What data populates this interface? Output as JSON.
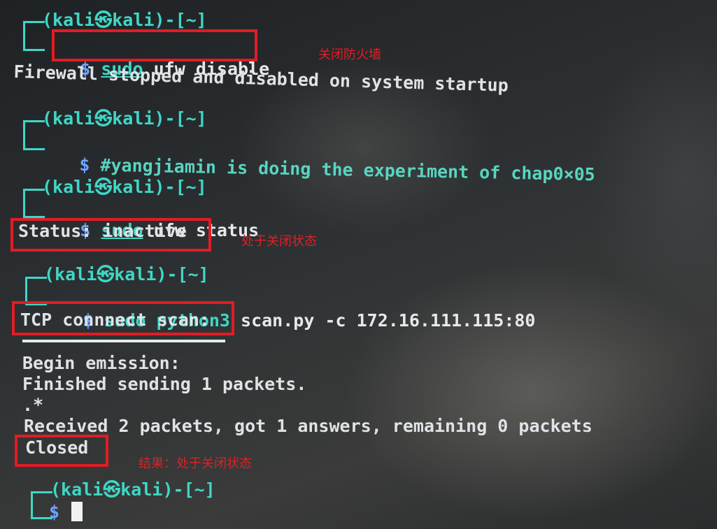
{
  "terminal": {
    "prompt_user": "(kali㉿kali)-[~]",
    "prompt_symbol": "$",
    "blocks": [
      {
        "command": [
          "sudo",
          " ufw disable"
        ],
        "output": [
          "Firewall stopped and disabled on system startup"
        ]
      },
      {
        "command": [
          "#yangjiamin is doing the experiment of chap0×05"
        ],
        "output": []
      },
      {
        "command": [
          "sudo",
          " ufw status"
        ],
        "output": [
          "Status: inactive"
        ]
      },
      {
        "command": [
          "sudo",
          " python3 ",
          "scan.py",
          " -c 172.16.111.115:80"
        ],
        "output": [
          "TCP connnect scan:",
          "Begin emission:",
          "Finished sending 1 packets.",
          ".*",
          "Received 2 packets, got 1 answers, remaining 0 packets",
          "Closed"
        ]
      }
    ]
  },
  "annotations": {
    "firewall_off": "关闭防火墙",
    "status_off": "处于关闭状态",
    "result": "结果：处于关闭状态"
  },
  "colors": {
    "prompt": "#3fd7c6",
    "comment": "#58d5c0",
    "highlight_box": "#e21c24"
  }
}
